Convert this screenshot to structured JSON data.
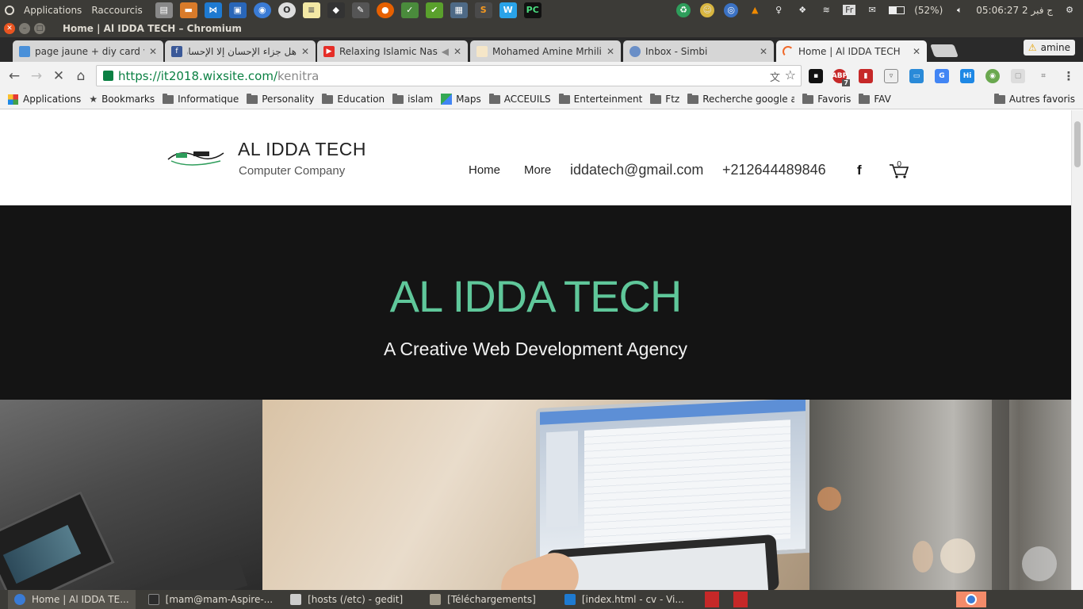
{
  "panel": {
    "menu": [
      "Applications",
      "Raccourcis"
    ],
    "battery": "(52%)",
    "clock": "05:06:27 2 ج فبر",
    "lang": "Fr"
  },
  "window": {
    "title": "Home | Al IDDA TECH – Chromium"
  },
  "tabs": [
    {
      "label": "page jaune + diy card v + w",
      "color": "#4a90d9"
    },
    {
      "label": "هل جزاء الإحسان إلا الإحسان",
      "color": "#3b5998"
    },
    {
      "label": "Relaxing Islamic Nashe",
      "color": "#e52d27"
    },
    {
      "label": "Mohamed Amine Mrhili",
      "color": "#f5e6c8"
    },
    {
      "label": "Inbox - Simbi",
      "color": "#6a8fc7"
    },
    {
      "label": "Home | Al IDDA TECH",
      "color": "#f06a2b"
    }
  ],
  "profile": {
    "name": "amine"
  },
  "toolbar": {
    "url_host": "https://it2018.wixsite.com/",
    "url_path": "kenitra",
    "abp_count": "7"
  },
  "bookmarks": [
    "Applications",
    "Bookmarks",
    "Informatique",
    "Personality",
    "Education",
    "islam",
    "Maps",
    "ACCEUILS",
    "Enterteinment",
    "Ftz",
    "Recherche google a tr",
    "Favoris",
    "FAV"
  ],
  "bookmarks_other": "Autres favoris",
  "site": {
    "brand": "AL IDDA TECH",
    "tagline": "Computer Company",
    "nav_home": "Home",
    "nav_more": "More",
    "email": "iddatech@gmail.com",
    "phone": "+212644489846",
    "cart_count": "0",
    "hero_title": "AL IDDA TECH",
    "hero_subtitle": "A Creative Web Development Agency",
    "accent": "#5fc79a"
  },
  "dock": [
    "Home | Al IDDA TE...",
    "[mam@mam-Aspire-...",
    "[hosts (/etc) - gedit]",
    "[Téléchargements]",
    "[index.html - cv - Vi..."
  ]
}
